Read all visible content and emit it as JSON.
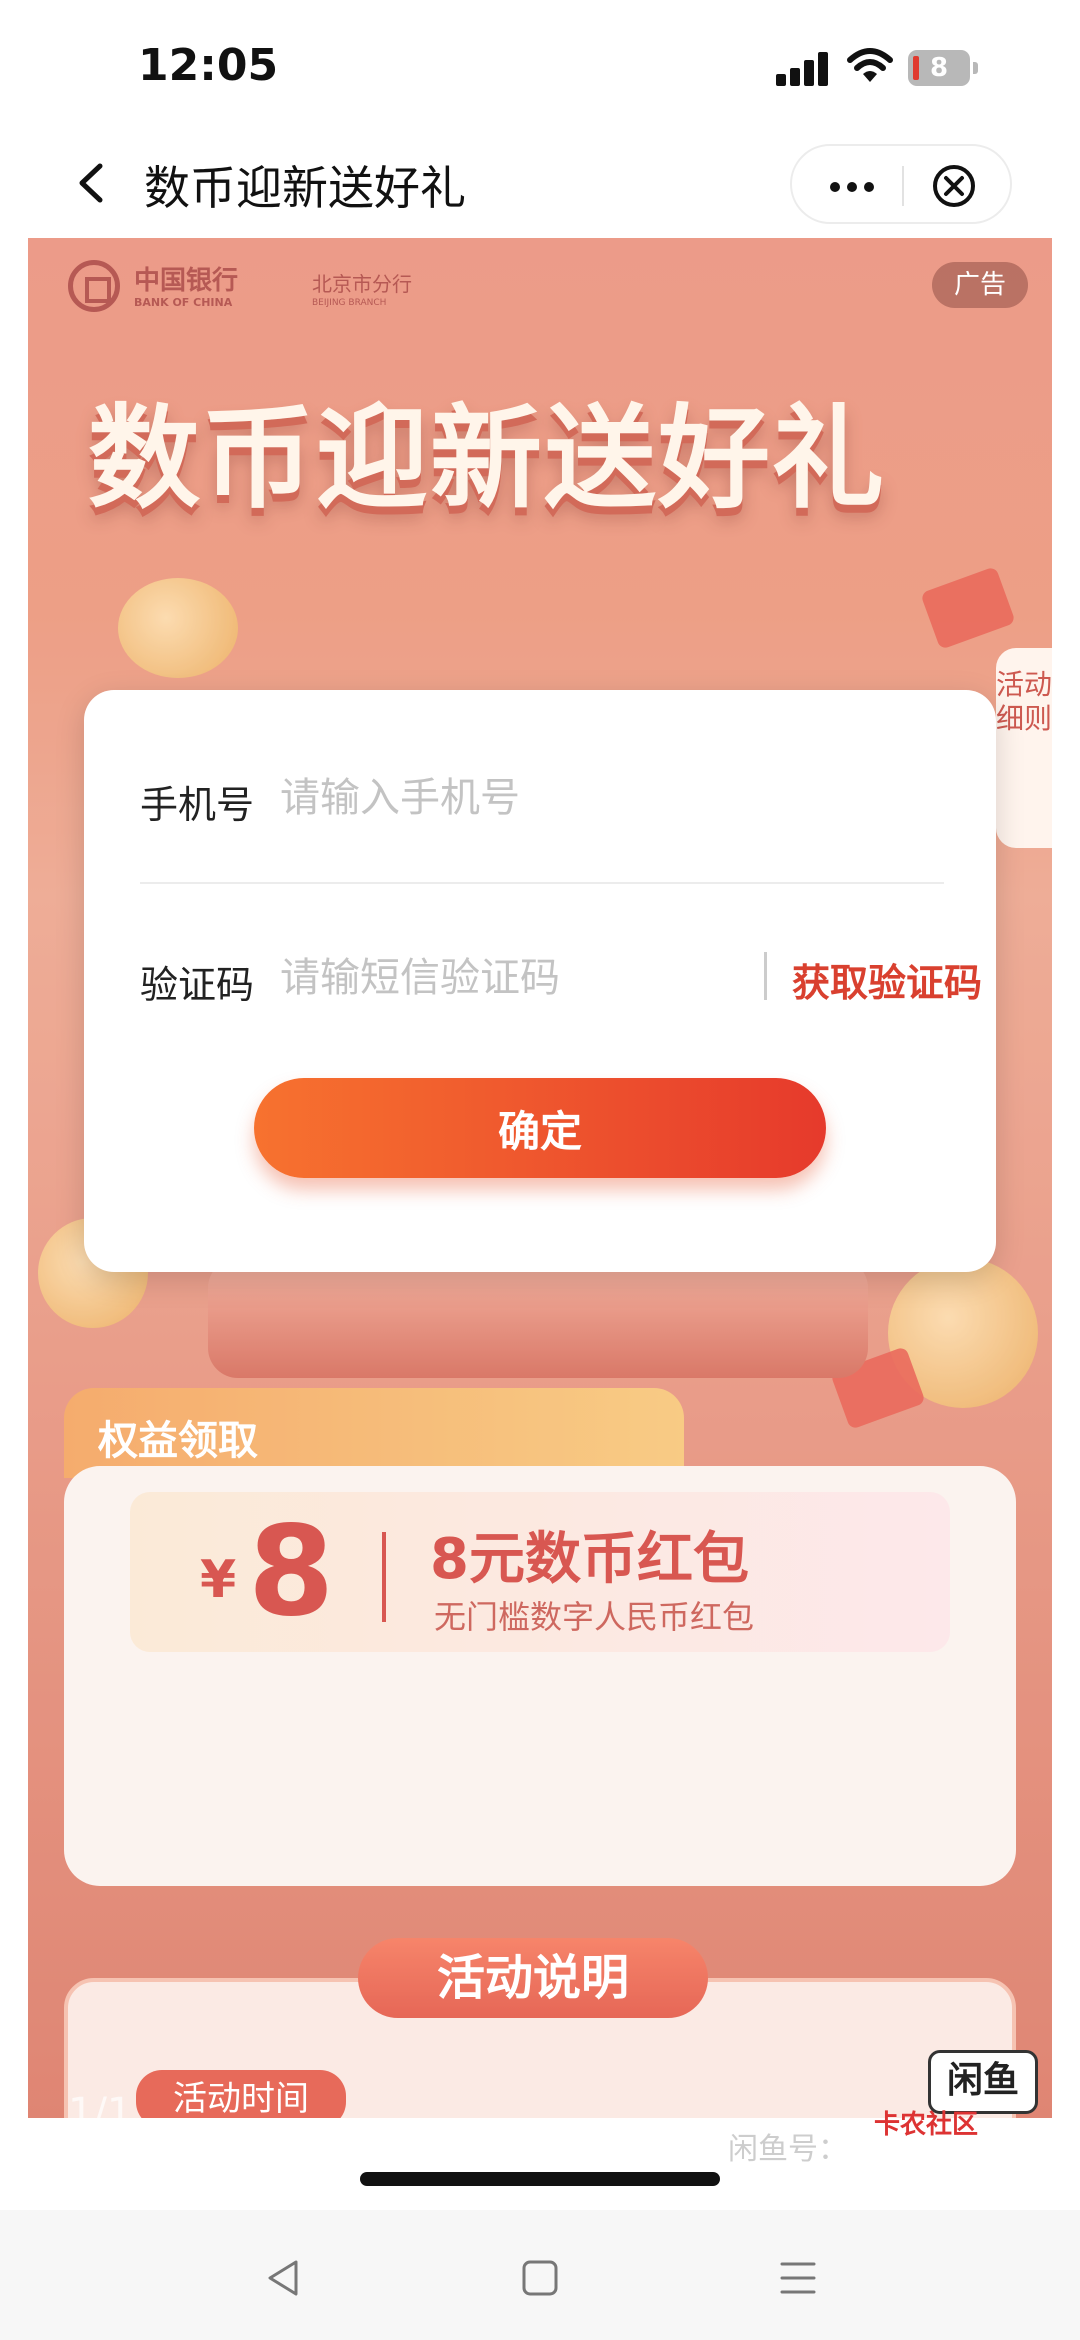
{
  "status_bar": {
    "time": "12:05",
    "battery": "8"
  },
  "nav": {
    "title": "数币迎新送好礼"
  },
  "banner": {
    "bank_name_cn": "中国银行",
    "bank_name_en": "BANK OF CHINA",
    "branch_cn": "北京市分行",
    "branch_en": "BEIJING BRANCH",
    "ad_label": "广告",
    "hero_title": "数币迎新送好礼",
    "side_tab": "活动细则"
  },
  "modal": {
    "phone_label": "手机号",
    "phone_placeholder": "请输入手机号",
    "code_label": "验证码",
    "code_placeholder": "请输短信验证码",
    "get_code": "获取验证码",
    "confirm": "确定"
  },
  "rights": {
    "tab_label": "权益领取",
    "currency": "¥",
    "amount": "8",
    "coupon_name": "8元数币红包",
    "coupon_desc": "无门槛数字人民币红包"
  },
  "activity": {
    "title": "活动说明",
    "time_label": "活动时间"
  },
  "overlay_marks": {
    "page_indicator": "1/1",
    "xianyu": "闲鱼",
    "watermark": "闲鱼号：",
    "kanong": "卡农社区"
  },
  "colors": {
    "accent": "#e63a2c",
    "link": "#d9402f"
  }
}
